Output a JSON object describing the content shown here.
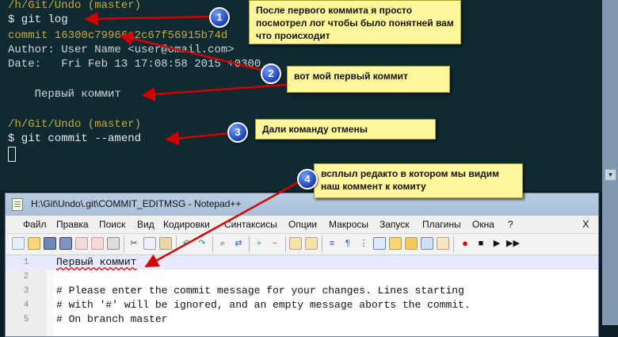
{
  "terminal": {
    "prompt1": "/h/Git/Undo (master)",
    "cmd1": "$ git log",
    "commit": "commit 16300c79966a2c67f56915b74d",
    "author": "Author: User Name <user@omail.com>",
    "date": "Date:   Fri Feb 13 17:08:58 2015 +0300",
    "message": "    Первый коммит",
    "prompt2": "/h/Git/Undo (master)",
    "cmd2": "$ git commit --amend"
  },
  "callouts": [
    {
      "number": "1",
      "text": "После первого коммита я просто посмотрел лог чтобы было понятней вам что происходит"
    },
    {
      "number": "2",
      "text": "вот мой первый коммит"
    },
    {
      "number": "3",
      "text": "Дали команду отмены"
    },
    {
      "number": "4",
      "text": "всплыл редакто в котором мы видим наш коммент к комиту"
    }
  ],
  "notepad": {
    "title": "H:\\Git\\Undo\\.git\\COMMIT_EDITMSG - Notepad++",
    "menu": [
      "Файл",
      "Правка",
      "Поиск",
      "Вид",
      "Кодировки",
      "Синтаксисы",
      "Опции",
      "Макросы",
      "Запуск",
      "Плагины",
      "Окна",
      "?"
    ],
    "close_label": "X",
    "lines": [
      {
        "num": "1",
        "text": "Первый коммит"
      },
      {
        "num": "2",
        "text": ""
      },
      {
        "num": "3",
        "text": "# Please enter the commit message for your changes. Lines starting"
      },
      {
        "num": "4",
        "text": "# with '#' will be ignored, and an empty message aborts the commit."
      },
      {
        "num": "5",
        "text": "# On branch master"
      }
    ],
    "toolbar_icons": [
      "new-file-icon",
      "open-file-icon",
      "save-icon",
      "save-all-icon",
      "close-icon",
      "close-all-icon",
      "print-icon",
      "cut-icon",
      "copy-icon",
      "paste-icon",
      "undo-icon",
      "redo-icon",
      "find-icon",
      "replace-icon",
      "zoom-in-icon",
      "zoom-out-icon",
      "sync-v-icon",
      "sync-h-icon",
      "word-wrap-icon",
      "show-all-chars-icon",
      "indent-guide-icon",
      "doc-map-icon",
      "function-list-icon",
      "folder-icon",
      "monitor-icon",
      "record-macro-icon",
      "stop-macro-icon",
      "play-macro-icon",
      "run-macro-multiple-icon",
      "save-macro-icon"
    ]
  },
  "colors": {
    "terminal_bg": "#0f2a33",
    "prompt": "#c7a93a",
    "callout_bg": "#fff799",
    "badge": "#1b3fb6",
    "arrow": "#d40000"
  }
}
